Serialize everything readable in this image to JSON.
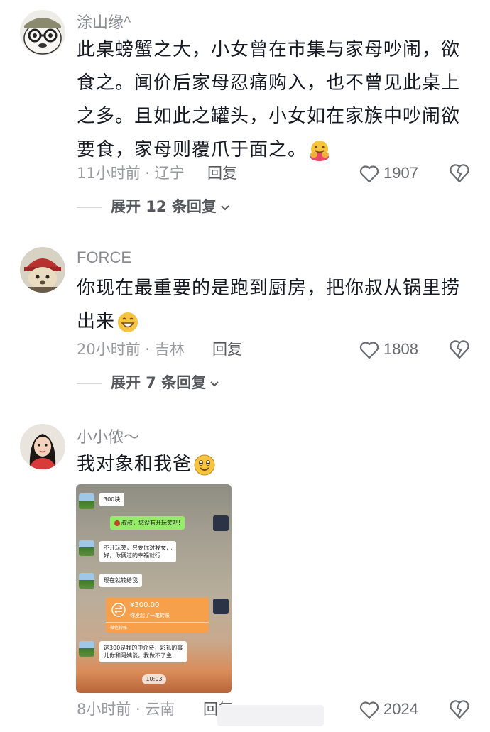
{
  "comments": [
    {
      "username": "涂山缘^",
      "text": "此桌螃蟹之大，小女曾在市集与家母吵闹，欲食之。闻价后家母忍痛购入，也不曾见此桌上之多。且如此之罐头，小女如在家族中吵闹欲要食，家母则覆爪于面之。",
      "emoji": "hugging-face",
      "time_location": "11小时前 · 辽宁",
      "reply_label": "回复",
      "likes": "1907",
      "expand_label": "展开 12 条回复"
    },
    {
      "username": "FORCE",
      "text": "你现在最重要的是跑到厨房，把你叔从锅里捞出来",
      "emoji": "grinning-face",
      "time_location": "20小时前 · 吉林",
      "reply_label": "回复",
      "likes": "1808",
      "expand_label": "展开 7 条回复"
    },
    {
      "username": "小小侬～",
      "text": "我对象和我爸",
      "emoji": "smiling-face",
      "time_location": "8小时前 · 云南",
      "reply_label": "回复",
      "likes": "2024"
    }
  ],
  "chat_image": {
    "msg1": "300块",
    "msg2": "叔叔，您没有开玩笑吧!",
    "msg3_line1": "不开玩笑，只要你对我女儿",
    "msg3_line2": "好，你俩过的幸福就行",
    "msg4": "现在就转给我",
    "transfer_amount": "¥300.00",
    "transfer_note": "你发起了一笔转账",
    "transfer_footer": "微信转账",
    "msg5_line1": "这300是我的中介费，彩礼的事",
    "msg5_line2": "儿你和阿姨谈，我做不了主",
    "time": "10:03"
  },
  "colors": {
    "text": "#161823",
    "meta": "#9a9ba1",
    "wechat_green": "#95ec69",
    "transfer_orange": "#f7a04b"
  }
}
